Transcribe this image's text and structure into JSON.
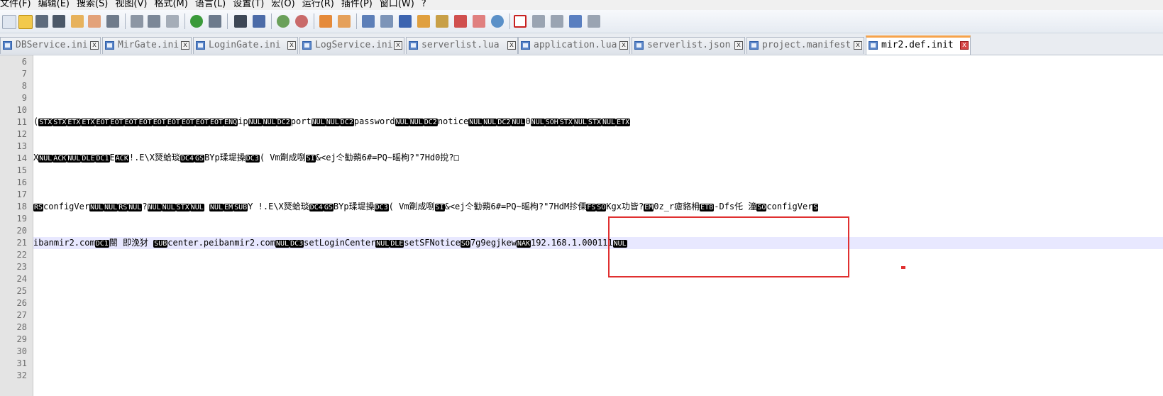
{
  "menu": [
    "文件(F)",
    "编辑(E)",
    "搜索(S)",
    "视图(V)",
    "格式(M)",
    "语言(L)",
    "设置(T)",
    "宏(O)",
    "运行(R)",
    "插件(P)",
    "窗口(W)",
    "?"
  ],
  "tabs": [
    {
      "label": "DBService.ini",
      "close": "x",
      "active": false
    },
    {
      "label": "MirGate.ini",
      "close": "x",
      "active": false
    },
    {
      "label": "LoginGate.ini",
      "close": "x",
      "active": false
    },
    {
      "label": "LogService.ini",
      "close": "x",
      "active": false
    },
    {
      "label": "serverlist.lua",
      "close": "x",
      "active": false
    },
    {
      "label": "application.lua",
      "close": "x",
      "active": false
    },
    {
      "label": "serverlist.json",
      "close": "x",
      "active": false
    },
    {
      "label": "project.manifest",
      "close": "x",
      "active": false
    },
    {
      "label": "mir2.def.init",
      "close": "x",
      "active": true
    }
  ],
  "line_numbers": [
    "6",
    "7",
    "8",
    "9",
    "10",
    "11",
    "12",
    "13",
    "14",
    "15",
    "16",
    "17",
    "18",
    "19",
    "20",
    "21",
    "22",
    "23",
    "24",
    "25",
    "26",
    "27",
    "28",
    "29",
    "30",
    "31",
    "32"
  ],
  "lines": {
    "l11": [
      {
        "t": "(",
        "c": false
      },
      {
        "t": "STX",
        "c": true
      },
      {
        "t": "STX",
        "c": true
      },
      {
        "t": "ETX",
        "c": true
      },
      {
        "t": "ETX",
        "c": true
      },
      {
        "t": "EOT",
        "c": true
      },
      {
        "t": "EOT",
        "c": true
      },
      {
        "t": "EOT",
        "c": true
      },
      {
        "t": "EOT",
        "c": true
      },
      {
        "t": "EOT",
        "c": true
      },
      {
        "t": "EOT",
        "c": true
      },
      {
        "t": "EOT",
        "c": true
      },
      {
        "t": "EOT",
        "c": true
      },
      {
        "t": "EOT",
        "c": true
      },
      {
        "t": "ENQ",
        "c": true
      },
      {
        "t": "ip",
        "c": false
      },
      {
        "t": "NUL",
        "c": true
      },
      {
        "t": "NUL",
        "c": true
      },
      {
        "t": "DC2",
        "c": true
      },
      {
        "t": "port",
        "c": false
      },
      {
        "t": "NUL",
        "c": true
      },
      {
        "t": "NUL",
        "c": true
      },
      {
        "t": "DC2",
        "c": true
      },
      {
        "t": "password",
        "c": false
      },
      {
        "t": "NUL",
        "c": true
      },
      {
        "t": "NUL",
        "c": true
      },
      {
        "t": "DC2",
        "c": true
      },
      {
        "t": "notice",
        "c": false
      },
      {
        "t": "NUL",
        "c": true
      },
      {
        "t": "NUL",
        "c": true
      },
      {
        "t": "DC2",
        "c": true
      },
      {
        "t": "NUL",
        "c": true
      },
      {
        "t": "0",
        "c": false
      },
      {
        "t": "NUL",
        "c": true
      },
      {
        "t": "SOH",
        "c": true
      },
      {
        "t": "STX",
        "c": true
      },
      {
        "t": "NUL",
        "c": true
      },
      {
        "t": "STX",
        "c": true
      },
      {
        "t": "NUL",
        "c": true
      },
      {
        "t": "ETX",
        "c": true
      }
    ],
    "l14": [
      {
        "t": "X",
        "c": false
      },
      {
        "t": "NUL",
        "c": true
      },
      {
        "t": "ACK",
        "c": true
      },
      {
        "t": "NUL",
        "c": true
      },
      {
        "t": "DLE",
        "c": true
      },
      {
        "t": "DC1",
        "c": true
      },
      {
        "t": "E",
        "c": false
      },
      {
        "t": "ACK",
        "c": true
      },
      {
        "t": "!.E\\X燹蛤琰",
        "c": false
      },
      {
        "t": "DC4",
        "c": true
      },
      {
        "t": "GS",
        "c": true
      },
      {
        "t": "BYp瑈堤搡",
        "c": false
      },
      {
        "t": "DC3",
        "c": true
      },
      {
        "t": "( Vm劕成哵",
        "c": false
      },
      {
        "t": "SI",
        "c": true
      },
      {
        "t": "&<ej仒勧蒴6#=PQ~暚枸?\"7Hd0挩?□",
        "c": false
      }
    ],
    "l18": [
      {
        "t": "RS",
        "c": true
      },
      {
        "t": "configVer",
        "c": false
      },
      {
        "t": "NUL",
        "c": true
      },
      {
        "t": "NUL",
        "c": true
      },
      {
        "t": "RS",
        "c": true
      },
      {
        "t": "NUL",
        "c": true
      },
      {
        "t": "?",
        "c": false
      },
      {
        "t": "NUL",
        "c": true
      },
      {
        "t": "NUL",
        "c": true
      },
      {
        "t": "STX",
        "c": true
      },
      {
        "t": "NUL",
        "c": true
      },
      {
        "t": "    ",
        "c": false
      },
      {
        "t": "NUL",
        "c": true
      },
      {
        "t": "EM",
        "c": true
      },
      {
        "t": "SUB",
        "c": true
      },
      {
        "t": "Y  !.E\\X燹蛤琰",
        "c": false
      },
      {
        "t": "DC4",
        "c": true
      },
      {
        "t": "GS",
        "c": true
      },
      {
        "t": "BYp瑈堤搡",
        "c": false
      },
      {
        "t": "DC3",
        "c": true
      },
      {
        "t": "(  Vm劕成哵",
        "c": false
      },
      {
        "t": "SI",
        "c": true
      },
      {
        "t": "&<ej仒勧蒴6#=PQ~暚枸?\"7HdM抮傈",
        "c": false
      },
      {
        "t": "FS",
        "c": true
      },
      {
        "t": "SO",
        "c": true
      },
      {
        "t": "Kgx功皆?",
        "c": false
      },
      {
        "t": "EM",
        "c": true
      },
      {
        "t": "0z_r瘧貉枏",
        "c": false
      },
      {
        "t": "ETB",
        "c": true
      },
      {
        "t": "-Dfs仛  潼",
        "c": false
      },
      {
        "t": "SO",
        "c": true
      },
      {
        "t": "configVer",
        "c": false
      },
      {
        "t": "S",
        "c": true
      }
    ],
    "l21": [
      {
        "t": "ibanmir2.com",
        "c": false
      },
      {
        "t": "DC1",
        "c": true
      },
      {
        "t": "閿  即浼犲  ",
        "c": false
      },
      {
        "t": "SUB",
        "c": true
      },
      {
        "t": "center.peibanmir2.com",
        "c": false
      },
      {
        "t": "NUL",
        "c": true
      },
      {
        "t": "DC3",
        "c": true
      },
      {
        "t": "setLoginCenter",
        "c": false
      },
      {
        "t": "NUL",
        "c": true
      },
      {
        "t": "DLE",
        "c": true
      },
      {
        "t": "setSFNotice",
        "c": false
      },
      {
        "t": "SO",
        "c": true
      },
      {
        "t": "7g9egjkew",
        "c": false
      },
      {
        "t": "NAK",
        "c": true
      },
      {
        "t": "192.168.1.000111",
        "c": false
      },
      {
        "t": "NUL",
        "c": true
      }
    ]
  },
  "colors": {
    "annotation": "#e03030",
    "active_tab_accent": "#f7a34a",
    "current_line": "#e8e8ff"
  }
}
